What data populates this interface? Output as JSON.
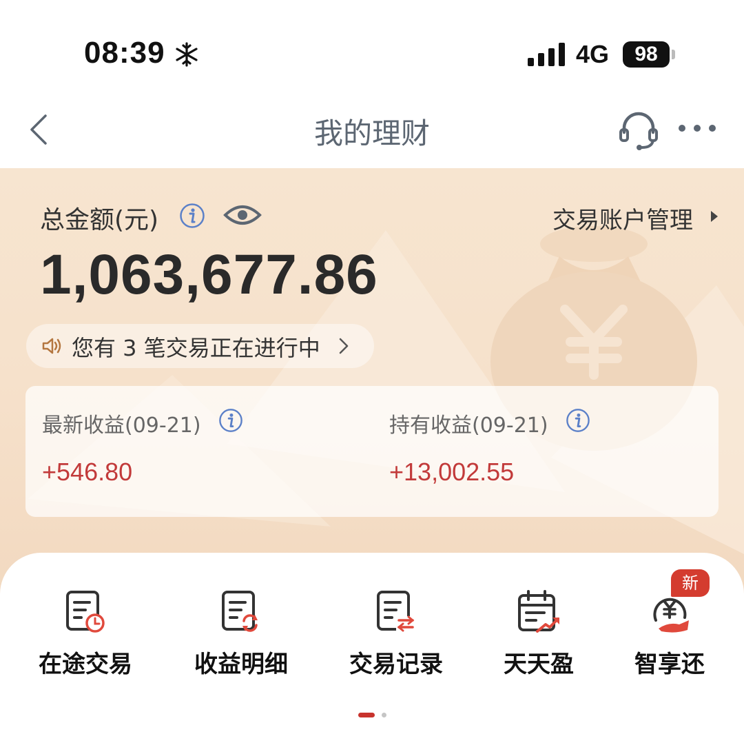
{
  "status_bar": {
    "time": "08:39",
    "network": "4G",
    "battery": "98",
    "icons": [
      "snowflake-icon",
      "signal-bars-icon",
      "battery-icon"
    ]
  },
  "nav": {
    "title": "我的理财",
    "icons": [
      "back-icon",
      "headset-icon",
      "more-icon"
    ]
  },
  "summary": {
    "total_label": "总金额(元)",
    "total_amount": "1,063,677.86",
    "account_link": "交易账户管理",
    "notice": "您有 3 笔交易正在进行中"
  },
  "earnings": {
    "latest_label": "最新收益(09-21)",
    "latest_value": "+546.80",
    "holding_label": "持有收益(09-21)",
    "holding_value": "+13,002.55"
  },
  "shortcuts": [
    {
      "label": "在途交易",
      "icon": "pending-trade-icon"
    },
    {
      "label": "收益明细",
      "icon": "earnings-detail-icon"
    },
    {
      "label": "交易记录",
      "icon": "trade-record-icon"
    },
    {
      "label": "天天盈",
      "icon": "calendar-growth-icon"
    },
    {
      "label": "智享还",
      "icon": "yuan-repay-icon",
      "badge": "新"
    }
  ],
  "colors": {
    "accent_red": "#c8332d",
    "value_red": "#c23a3a",
    "hero_bg": "#f7e5d0"
  }
}
